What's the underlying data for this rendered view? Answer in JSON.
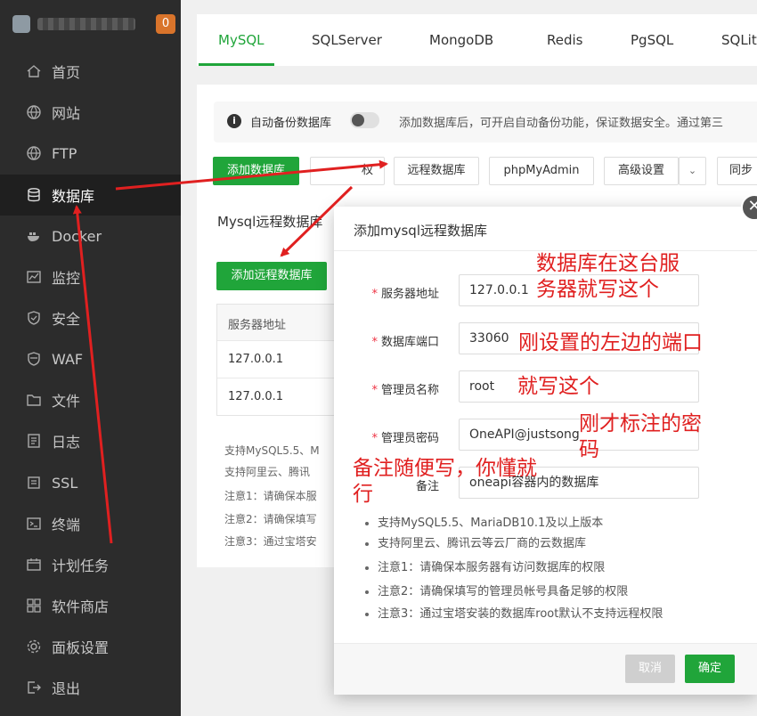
{
  "sidebar": {
    "badge": "0",
    "items": [
      {
        "label": "首页",
        "icon": "home-icon"
      },
      {
        "label": "网站",
        "icon": "globe-icon"
      },
      {
        "label": "FTP",
        "icon": "globe-icon"
      },
      {
        "label": "数据库",
        "icon": "database-icon"
      },
      {
        "label": "Docker",
        "icon": "docker-icon"
      },
      {
        "label": "监控",
        "icon": "monitor-icon"
      },
      {
        "label": "安全",
        "icon": "shield-icon"
      },
      {
        "label": "WAF",
        "icon": "waf-shield-icon"
      },
      {
        "label": "文件",
        "icon": "folder-icon"
      },
      {
        "label": "日志",
        "icon": "log-icon"
      },
      {
        "label": "SSL",
        "icon": "ssl-icon"
      },
      {
        "label": "终端",
        "icon": "terminal-icon"
      },
      {
        "label": "计划任务",
        "icon": "calendar-icon"
      },
      {
        "label": "软件商店",
        "icon": "apps-icon"
      },
      {
        "label": "面板设置",
        "icon": "gear-icon"
      },
      {
        "label": "退出",
        "icon": "logout-icon"
      }
    ]
  },
  "tabs": [
    "MySQL",
    "SQLServer",
    "MongoDB",
    "Redis",
    "PgSQL",
    "SQLit"
  ],
  "notice": {
    "label": "自动备份数据库",
    "text": "添加数据库后，可开启自动备份功能，保证数据安全。通过第三"
  },
  "toolbar": {
    "add_db": "添加数据库",
    "partial": "权",
    "remote_db": "远程数据库",
    "phpmyadmin": "phpMyAdmin",
    "advanced": "高级设置",
    "sync": "同步"
  },
  "section_title": "Mysql远程数据库",
  "add_remote_btn": "添加远程数据库",
  "table": {
    "header": "服务器地址",
    "rows": [
      "127.0.0.1",
      "127.0.0.1"
    ]
  },
  "bg_tips": [
    "支持MySQL5.5、M",
    "支持阿里云、腾讯",
    "注意1：请确保本服",
    "注意2：请确保填写",
    "注意3：通过宝塔安"
  ],
  "modal": {
    "title": "添加mysql远程数据库",
    "fields": [
      {
        "label": "服务器地址",
        "value": "127.0.0.1",
        "required": true
      },
      {
        "label": "数据库端口",
        "value": "33060",
        "required": true
      },
      {
        "label": "管理员名称",
        "value": "root",
        "required": true
      },
      {
        "label": "管理员密码",
        "value": "OneAPI@justsong",
        "required": true
      },
      {
        "label": "备注",
        "value": "oneapi容器内的数据库",
        "required": false
      }
    ],
    "tips": [
      "支持MySQL5.5、MariaDB10.1及以上版本",
      "支持阿里云、腾讯云等云厂商的云数据库",
      "注意1：请确保本服务器有访问数据库的权限",
      "注意2：请确保填写的管理员帐号具备足够的权限",
      "注意3：通过宝塔安装的数据库root默认不支持远程权限"
    ],
    "cancel": "取消",
    "confirm": "确定"
  },
  "annotations": {
    "a1_line1": "数据库在这台服",
    "a1_line2": "务器就写这个",
    "a2": "刚设置的左边的端口",
    "a3": "就写这个",
    "a4_line1": "刚才标注的密",
    "a4_line2": "码",
    "a5_line1": "备注随便写，你懂就",
    "a5_line2": "行"
  },
  "colors": {
    "accent": "#20a53a",
    "annotation": "#e02020",
    "sidebar": "#2c2c2c",
    "badge": "#d9742b"
  }
}
